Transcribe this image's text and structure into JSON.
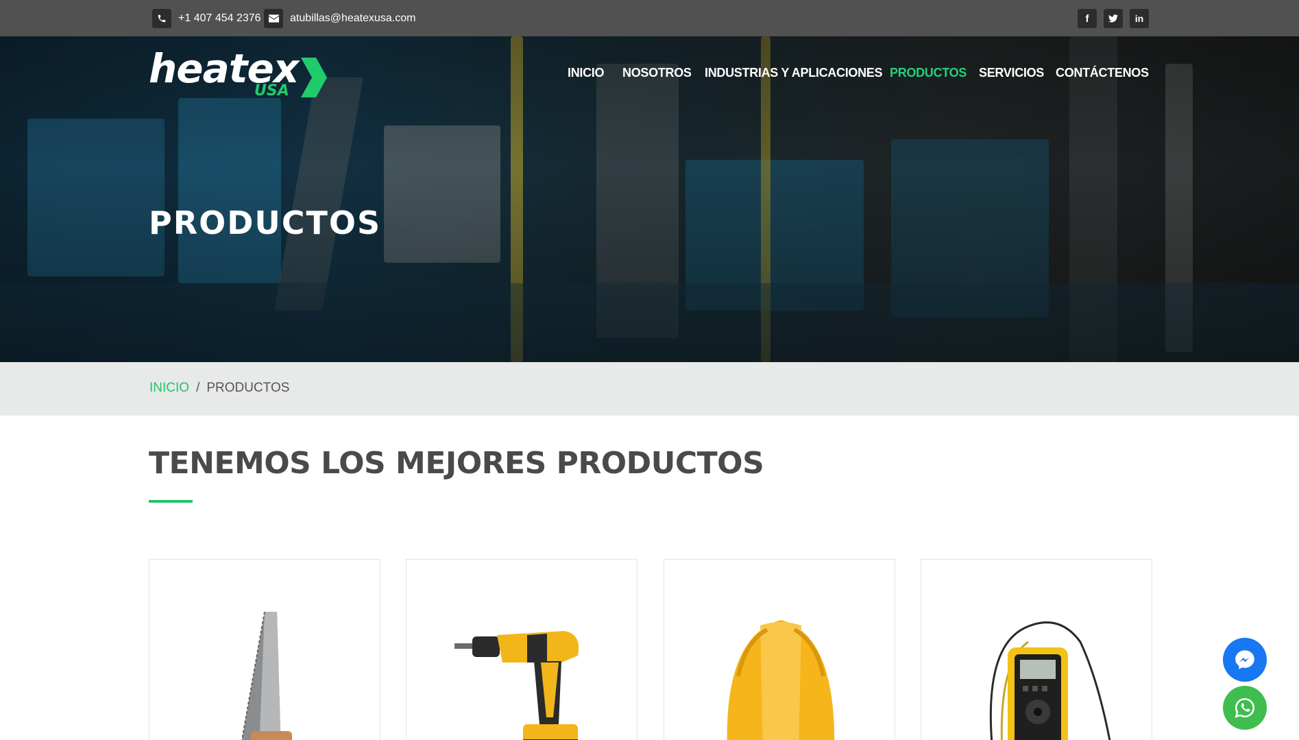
{
  "topbar": {
    "phone": "+1 407 454 2376",
    "email": "atubillas@heatexusa.com",
    "social": [
      {
        "icon": "facebook-icon",
        "glyph": "f"
      },
      {
        "icon": "twitter-icon",
        "glyph": "t"
      },
      {
        "icon": "linkedin-icon",
        "glyph": "in"
      }
    ]
  },
  "logo": {
    "main": "heatex",
    "sub": "USA"
  },
  "nav": {
    "items": [
      "INICIO",
      "NOSOTROS",
      "INDUSTRIAS Y APLICACIONES",
      "PRODUCTOS",
      "SERVICIOS",
      "CONTÁCTENOS"
    ],
    "active": "PRODUCTOS"
  },
  "hero": {
    "title": "PRODUCTOS"
  },
  "breadcrumb": {
    "home": "INICIO",
    "separator": "/",
    "current": "PRODUCTOS"
  },
  "section": {
    "title": "TENEMOS LOS MEJORES PRODUCTOS"
  },
  "products": [
    {
      "image": "hand-saw"
    },
    {
      "image": "cordless-drill"
    },
    {
      "image": "hard-hat"
    },
    {
      "image": "digital-multimeter"
    }
  ],
  "colors": {
    "accent": "#22c36b",
    "topbar": "#515151",
    "messenger": "#1877f2",
    "whatsapp": "#3fbd4f"
  }
}
